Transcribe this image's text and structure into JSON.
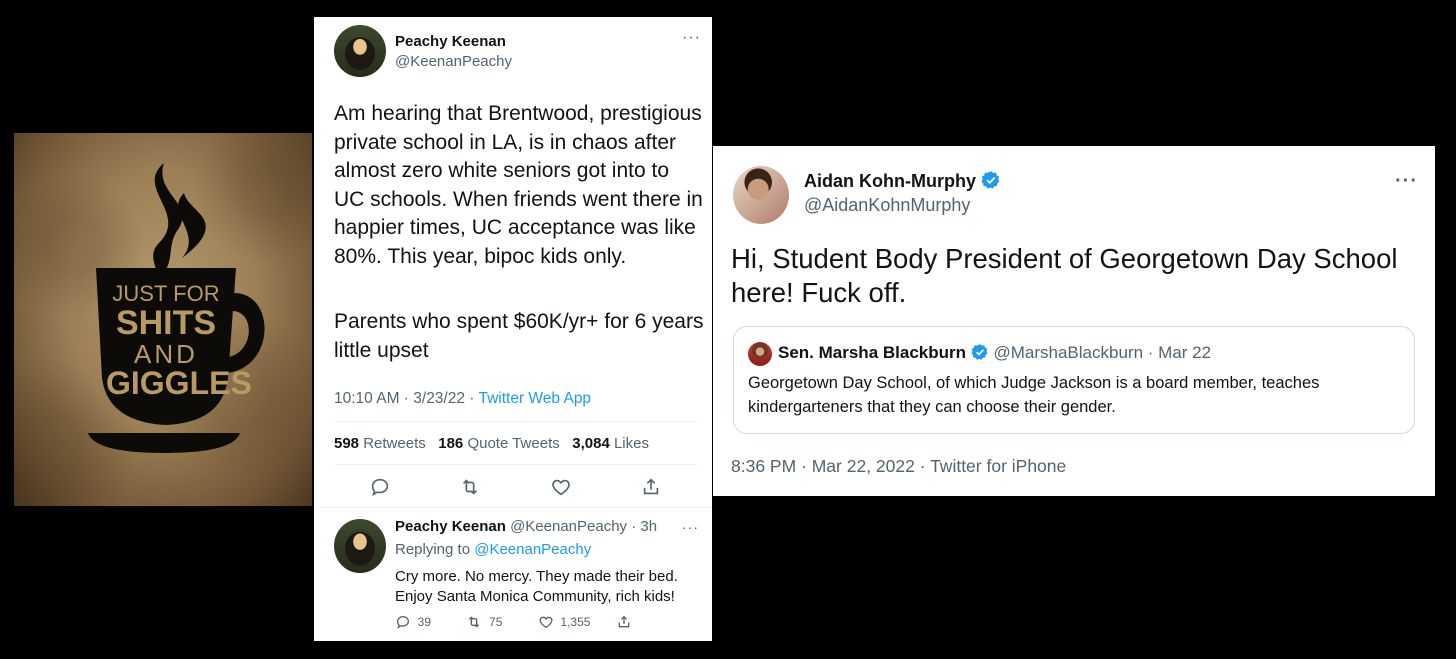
{
  "poster": {
    "line1": "JUST FOR",
    "line2": "SHITS",
    "line3": "AND",
    "line4": "GIGGLES"
  },
  "tweet1": {
    "name": "Peachy Keenan",
    "handle": "@KeenanPeachy",
    "more_icon": "more-horizontal-icon",
    "body_p1": "Am hearing that Brentwood, prestigious private school in LA, is in chaos after almost zero white seniors got into to UC schools. When friends went there in happier times, UC acceptance was like 80%. This year, bipoc kids only.",
    "body_p2": "Parents who spent $60K/yr+ for 6 years little upset",
    "time": "10:10 AM · 3/23/22 · ",
    "source": "Twitter Web App",
    "retweets_count": "598",
    "retweets_label": "Retweets",
    "quotes_count": "186",
    "quotes_label": "Quote Tweets",
    "likes_count": "3,084",
    "likes_label": "Likes",
    "reply": {
      "name": "Peachy Keenan",
      "handle_time": "@KeenanPeachy · 3h",
      "replying_prefix": "Replying to ",
      "replying_handle": "@KeenanPeachy",
      "text_line1": "Cry more. No mercy. They made their bed.",
      "text_line2": "Enjoy Santa Monica Community, rich kids!",
      "reply_count": "39",
      "retweet_count": "75",
      "like_count": "1,355"
    }
  },
  "tweet2": {
    "name": "Aidan Kohn-Murphy",
    "handle": "@AidanKohnMurphy",
    "body": "Hi, Student Body President of Georgetown Day School here! Fuck off.",
    "quote": {
      "name": "Sen. Marsha Blackburn",
      "handle_date": "@MarshaBlackburn · Mar 22",
      "text": "Georgetown Day School, of which Judge Jackson is a board member, teaches kindergarteners that they can choose their gender."
    },
    "timestamp": "8:36 PM · Mar 22, 2022 · Twitter for iPhone"
  },
  "colors": {
    "link": "#1d9bf0",
    "muted": "#536471",
    "text": "#0f1419",
    "verified": "#1d9bf0"
  }
}
